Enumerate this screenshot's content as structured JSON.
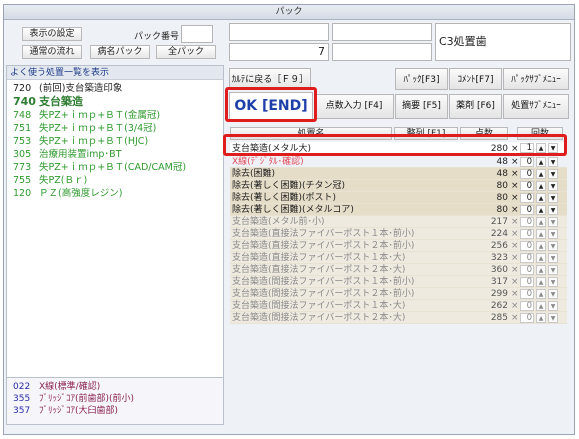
{
  "window": {
    "title": "パック"
  },
  "top": {
    "settings_button": "表示の設定",
    "pack_number_label": "パック番号",
    "pack_number_value": "",
    "normal_flow_button": "通常の流れ",
    "disease_pack_button": "病名パック",
    "all_pack_button": "全パック",
    "info_box_1": "",
    "info_box_2": "",
    "info_number": "7",
    "info_box_4": "",
    "procedure_name": "C3処置歯"
  },
  "left": {
    "title": "よく使う処置一覧を表示",
    "favorites": [
      {
        "code": "720",
        "name": "(前回)支台築造印象",
        "color": "#222222",
        "bold": false
      },
      {
        "code": "740",
        "name": "支台築造",
        "color": "#2e7d32",
        "bold": true
      },
      {
        "code": "748",
        "name": "失PZ+ｉｍｐ+ＢＴ(金属冠)",
        "color": "#2e9a2e",
        "bold": false
      },
      {
        "code": "751",
        "name": "失PZ+ｉｍｐ+ＢＴ(3/4冠)",
        "color": "#2e9a2e",
        "bold": false
      },
      {
        "code": "753",
        "name": "失PZ+ｉｍｐ+ＢＴ(HJC)",
        "color": "#2e9a2e",
        "bold": false
      },
      {
        "code": "305",
        "name": "治療用装置imp･BT",
        "color": "#2e9a2e",
        "bold": false
      },
      {
        "code": "773",
        "name": "失PZ+ｉｍｐ+ＢＴ(CAD/CAM冠)",
        "color": "#2e9a2e",
        "bold": false
      },
      {
        "code": "755",
        "name": "失PZ(Ｂｒ)",
        "color": "#2e9a2e",
        "bold": false
      },
      {
        "code": "120",
        "name": "ＰＺ(高強度レジン)",
        "color": "#2e9a2e",
        "bold": false
      }
    ],
    "bottom": [
      {
        "code": "022",
        "name": "X線(標準/確認)"
      },
      {
        "code": "355",
        "name": "ﾌﾞﾘｯｼﾞｺｱ(前歯部)(前小)"
      },
      {
        "code": "357",
        "name": "ﾌﾞﾘｯｼﾞｺｱ(大臼歯部)"
      }
    ]
  },
  "toolbar": {
    "back": "ｶﾙﾃに戻る［Ｆ９］",
    "pack_f3": "ﾊﾟｯｸ[F3]",
    "comment_f7": "ｺﾒﾝﾄ[F7]",
    "pack_submenu": "ﾊﾟｯｸｻﾌﾞﾒﾆｭｰ",
    "ok_end": "OK [END]",
    "points_input_f4": "点数入力 [F4]",
    "summary_f5": "摘要 [F5]",
    "medicine_f6": "薬剤 [F6]",
    "treatment_submenu": "処置ｻﾌﾞﾒﾆｭｰ"
  },
  "table": {
    "col_name": "処置名",
    "col_arrange": "整列 [F1]",
    "col_points": "点数",
    "col_count": "回数",
    "rows": [
      {
        "name": "支台築造(メタル大)",
        "points": "280",
        "count": "1",
        "style": "sel"
      },
      {
        "name": "X線(ﾃﾞｼﾞﾀﾙ･確認)",
        "points": "48",
        "count": "0",
        "style": "pink"
      },
      {
        "name": "除去(困難)",
        "points": "48",
        "count": "0",
        "style": "norm"
      },
      {
        "name": "除去(著しく困難)(チタン冠)",
        "points": "80",
        "count": "0",
        "style": "norm"
      },
      {
        "name": "除去(著しく困難)(ポスト)",
        "points": "80",
        "count": "0",
        "style": "norm"
      },
      {
        "name": "除去(著しく困難)(メタルコア)",
        "points": "80",
        "count": "0",
        "style": "norm"
      },
      {
        "name": "支台築造(メタル前･小)",
        "points": "217",
        "count": "0",
        "style": "gray"
      },
      {
        "name": "支台築造(直接法ファイバーポスト１本･前小)",
        "points": "224",
        "count": "0",
        "style": "gray"
      },
      {
        "name": "支台築造(直接法ファイバーポスト２本･前小)",
        "points": "256",
        "count": "0",
        "style": "gray"
      },
      {
        "name": "支台築造(直接法ファイバーポスト１本･大)",
        "points": "323",
        "count": "0",
        "style": "gray"
      },
      {
        "name": "支台築造(直接法ファイバーポスト２本･大)",
        "points": "360",
        "count": "0",
        "style": "gray"
      },
      {
        "name": "支台築造(間接法ファイバーポスト１本･前小)",
        "points": "317",
        "count": "0",
        "style": "gray"
      },
      {
        "name": "支台築造(間接法ファイバーポスト２本･前小)",
        "points": "299",
        "count": "0",
        "style": "gray"
      },
      {
        "name": "支台築造(間接法ファイバーポスト１本･大)",
        "points": "262",
        "count": "0",
        "style": "gray"
      },
      {
        "name": "支台築造(間接法ファイバーポスト２本･大)",
        "points": "285",
        "count": "0",
        "style": "gray"
      }
    ]
  },
  "symbols": {
    "times": "×",
    "up": "▲",
    "down": "▼"
  },
  "colors": {
    "highlight_red": "#e01d1d",
    "ok_blue": "#1f3fa8"
  }
}
